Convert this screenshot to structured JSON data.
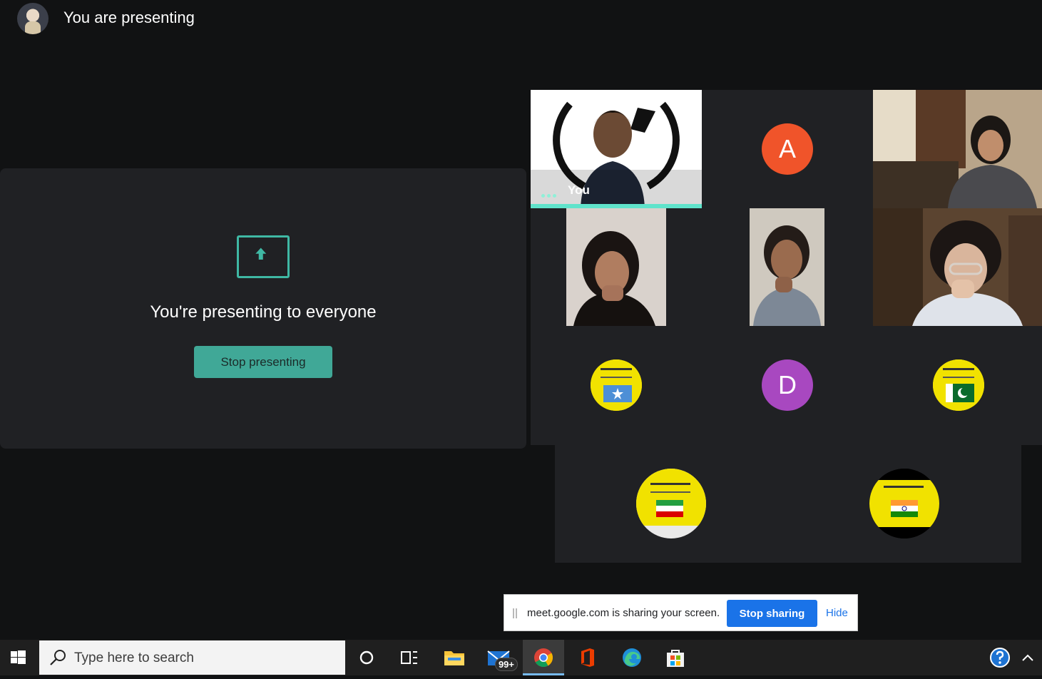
{
  "header": {
    "title": "You are presenting"
  },
  "presenting_panel": {
    "message": "You're presenting to everyone",
    "stop_button_label": "Stop presenting"
  },
  "participants": {
    "you_label": "You",
    "letter_a": "A",
    "letter_d": "D"
  },
  "share_bar": {
    "message": "meet.google.com is sharing your screen.",
    "stop_label": "Stop sharing",
    "hide_label": "Hide"
  },
  "taskbar": {
    "search_placeholder": "Type here to search",
    "mail_badge": "99+"
  },
  "colors": {
    "accent_teal": "#40a897",
    "avatar_a": "#f0542a",
    "avatar_d": "#a848c0",
    "share_blue": "#1a73e8"
  }
}
